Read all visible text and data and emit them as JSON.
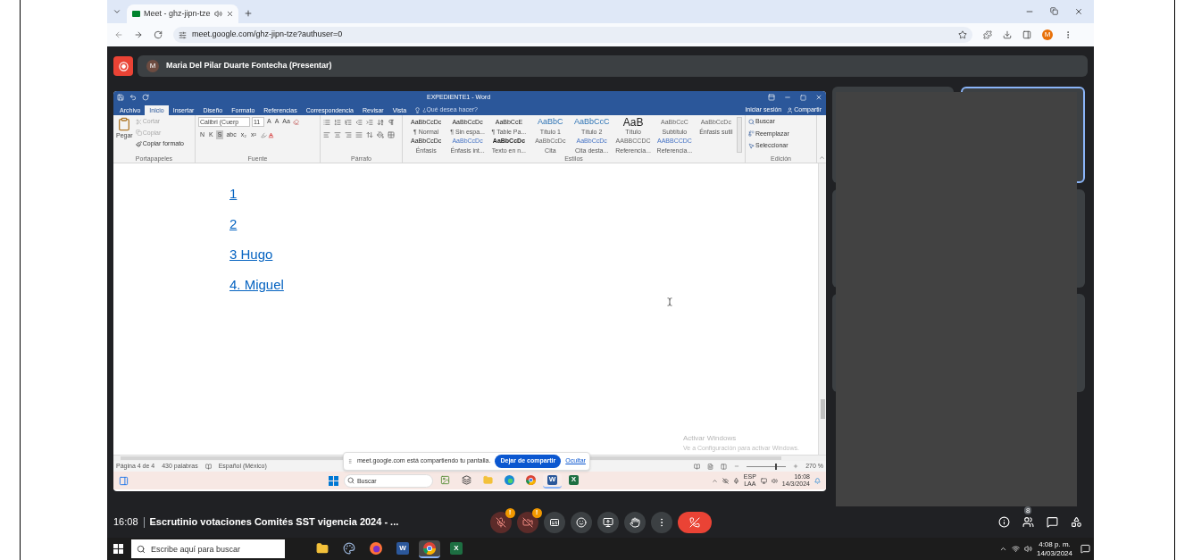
{
  "browser": {
    "tab_title": "Meet - ghz-jipn-tze",
    "url": "meet.google.com/ghz-jipn-tze?authuser=0",
    "profile": "M"
  },
  "presenter": {
    "avatar": "M",
    "name": "Maria Del Pilar Duarte Fontecha (Presentar)"
  },
  "word": {
    "title": "EXPEDIENTE1 - Word",
    "tabs": [
      {
        "label": "Archivo",
        "selected": false
      },
      {
        "label": "Inicio",
        "selected": true
      },
      {
        "label": "Insertar",
        "selected": false
      },
      {
        "label": "Diseño",
        "selected": false
      },
      {
        "label": "Formato",
        "selected": false
      },
      {
        "label": "Referencias",
        "selected": false
      },
      {
        "label": "Correspondencia",
        "selected": false
      },
      {
        "label": "Revisar",
        "selected": false
      },
      {
        "label": "Vista",
        "selected": false
      }
    ],
    "tell_me": {
      "placeholder": "¿Qué desea hacer?"
    },
    "sign_in": "Iniciar sesión",
    "share": "Compartir",
    "clipboard": {
      "label": "Portapapeles",
      "paste": "Pegar",
      "items": [
        {
          "kind": "cut",
          "label": "Cortar",
          "disabled": true
        },
        {
          "kind": "copy",
          "label": "Copiar",
          "disabled": true
        },
        {
          "kind": "format",
          "label": "Copiar formato",
          "disabled": false
        }
      ]
    },
    "font": {
      "label": "Fuente",
      "name": "Calibri (Cuerp",
      "size": "11",
      "size_buttons": [
        "A",
        "A",
        "Aa"
      ],
      "format_buttons": [
        {
          "label": "N",
          "selected": false
        },
        {
          "label": "K",
          "selected": false
        },
        {
          "label": "S",
          "selected": true
        },
        {
          "label": "abc",
          "selected": false
        },
        {
          "label": "x₂",
          "selected": false
        },
        {
          "label": "x²",
          "selected": false
        }
      ]
    },
    "paragraph": {
      "label": "Párrafo"
    },
    "styles": {
      "label": "Estilos",
      "items": [
        {
          "kind": "plain",
          "preview": "AaBbCcDc",
          "name": "¶ Normal"
        },
        {
          "kind": "plain",
          "preview": "AaBbCcDc",
          "name": "¶ Sin espa..."
        },
        {
          "kind": "plain",
          "preview": "AaBbCcE",
          "name": "¶ Table Pa..."
        },
        {
          "kind": "heading",
          "preview": "AaBbC",
          "name": "Título 1"
        },
        {
          "kind": "heading",
          "preview": "AaBbCcC",
          "name": "Título 2"
        },
        {
          "kind": "title",
          "preview": "AaB",
          "name": "Título"
        },
        {
          "kind": "subtle",
          "preview": "AaBbCcC",
          "name": "Subtítulo"
        },
        {
          "kind": "subtle",
          "preview": "AaBbCcDc",
          "name": "Énfasis sutil"
        },
        {
          "kind": "plain",
          "preview": "AaBbCcDc",
          "name": "Énfasis"
        },
        {
          "kind": "accent",
          "preview": "AaBbCcDc",
          "name": "Énfasis int..."
        },
        {
          "kind": "bold",
          "preview": "AaBbCcDc",
          "name": "Texto en n..."
        },
        {
          "kind": "subtle",
          "preview": "AaBbCcDc",
          "name": "Cita"
        },
        {
          "kind": "accent",
          "preview": "AaBbCcDc",
          "name": "Cita desta..."
        },
        {
          "kind": "subtle",
          "preview": "AABBCCDC",
          "name": "Referencia..."
        },
        {
          "kind": "accent",
          "preview": "AABBCCDC",
          "name": "Referencia..."
        }
      ]
    },
    "editing": {
      "label": "Edición",
      "items": [
        {
          "kind": "find",
          "label": "Buscar"
        },
        {
          "kind": "replace",
          "label": "Reemplazar"
        },
        {
          "kind": "select",
          "label": "Seleccionar"
        }
      ]
    },
    "document": {
      "lines": [
        "1",
        "2",
        "3 Hugo",
        "4. Miguel"
      ]
    },
    "activation": {
      "title": "Activar Windows",
      "message": "Ve a Configuración para activar Windows."
    },
    "status": {
      "page": "Página 4 de 4",
      "words": "430 palabras",
      "language": "Español (México)",
      "zoom": {
        "level": 0.72,
        "reading": "270 %"
      }
    },
    "taskbar": {
      "search": {
        "placeholder": "Buscar"
      },
      "language": "ESP",
      "layout": "LAA",
      "time": "16:08",
      "date": "14/3/2024",
      "apps": [
        {
          "kind": "widget",
          "active": false
        },
        {
          "kind": "taskview",
          "active": false
        },
        {
          "kind": "folder",
          "active": false
        },
        {
          "kind": "edge",
          "active": false
        },
        {
          "kind": "chrome",
          "active": false
        },
        {
          "kind": "word",
          "glyph": "W",
          "active": true
        },
        {
          "kind": "excel",
          "glyph": "X",
          "active": false
        }
      ]
    }
  },
  "share_banner": {
    "message": "meet.google.com está compartiendo tu pantalla.",
    "stop": "Dejar de compartir",
    "hide": "Ocultar"
  },
  "tiles": [
    {
      "highlighted": false
    },
    {
      "highlighted": true
    },
    {
      "highlighted": false
    },
    {
      "highlighted": false
    }
  ],
  "call": {
    "time": "16:08",
    "title": "Escrutinio votaciones Comités SST vigencia 2024 - ...",
    "people_count": "8",
    "controls": [
      {
        "kind": "mic",
        "off": true,
        "alert": "!"
      },
      {
        "kind": "camera",
        "off": true,
        "alert": "!"
      },
      {
        "kind": "captions"
      },
      {
        "kind": "emoji"
      },
      {
        "kind": "present"
      },
      {
        "kind": "hand"
      },
      {
        "kind": "more"
      },
      {
        "kind": "hangup"
      }
    ]
  },
  "windows_taskbar": {
    "search": {
      "placeholder": "Escribe aquí para buscar"
    },
    "time": "4:08 p. m.",
    "date": "14/03/2024",
    "apps": [
      {
        "kind": "folder",
        "active": false
      },
      {
        "kind": "paint",
        "active": false
      },
      {
        "kind": "firefox",
        "active": false
      },
      {
        "kind": "word",
        "glyph": "W",
        "active": false
      },
      {
        "kind": "chrome",
        "active": true
      },
      {
        "kind": "excel",
        "glyph": "X",
        "active": false
      }
    ]
  }
}
